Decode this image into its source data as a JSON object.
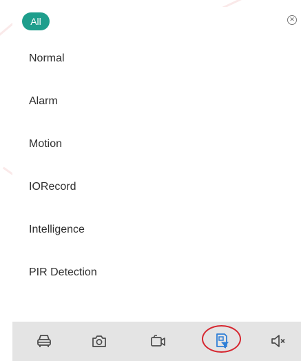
{
  "filter_panel": {
    "selected_chip": "All",
    "items": [
      {
        "label": "Normal"
      },
      {
        "label": "Alarm"
      },
      {
        "label": "Motion"
      },
      {
        "label": "IORecord"
      },
      {
        "label": "Intelligence"
      },
      {
        "label": "PIR Detection"
      }
    ]
  },
  "toolbar": {
    "buttons": [
      {
        "icon": "car-icon"
      },
      {
        "icon": "camera-icon"
      },
      {
        "icon": "video-record-icon"
      },
      {
        "icon": "record-filter-icon",
        "active": true
      },
      {
        "icon": "speaker-mute-icon"
      }
    ]
  },
  "colors": {
    "accent": "#1e9e8c",
    "active_icon": "#2f7fd6",
    "highlight_ring": "#d6262f",
    "toolbar_bg": "#e4e4e4"
  }
}
